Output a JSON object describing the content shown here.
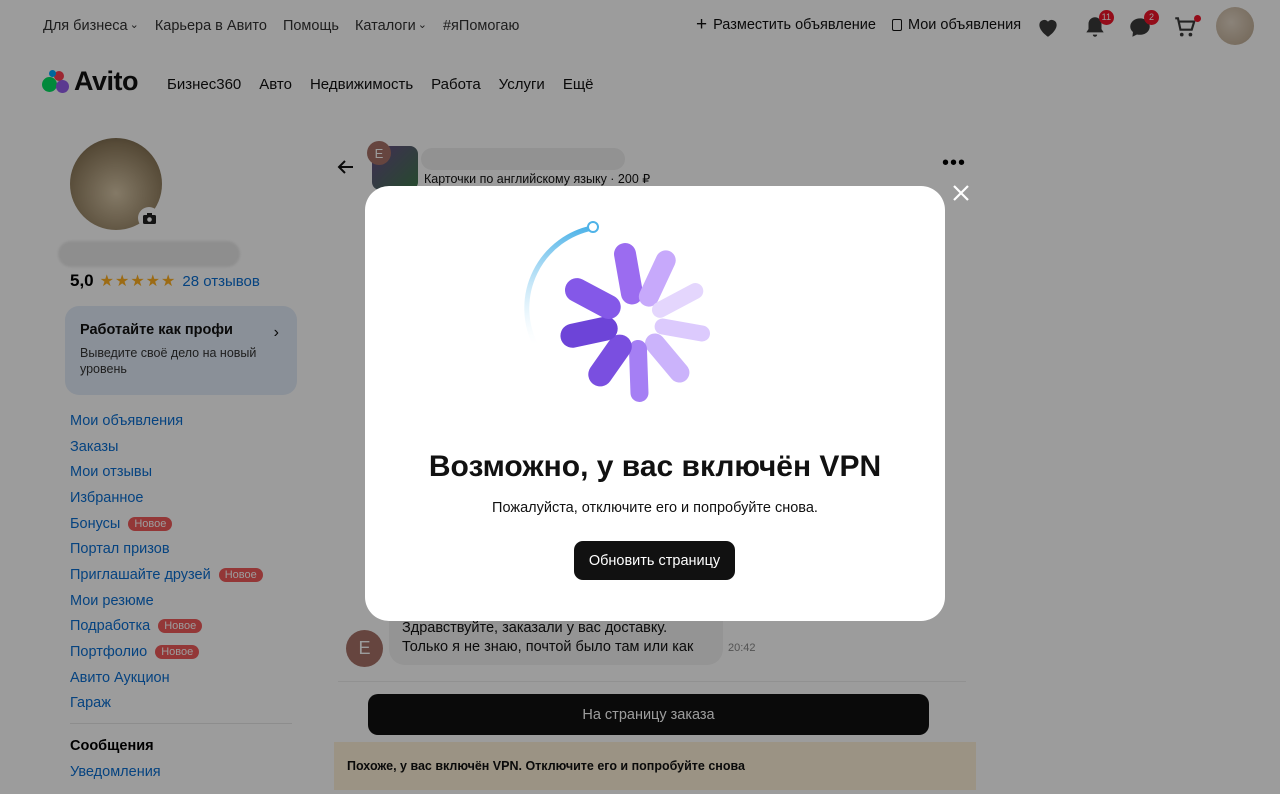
{
  "topbar": {
    "links": [
      {
        "label": "Для бизнеса",
        "dropdown": true
      },
      {
        "label": "Карьера в Авито",
        "dropdown": false
      },
      {
        "label": "Помощь",
        "dropdown": false
      },
      {
        "label": "Каталоги",
        "dropdown": true
      },
      {
        "label": "#яПомогаю",
        "dropdown": false
      }
    ],
    "post_ad": "Разместить объявление",
    "my_ads": "Мои объявления",
    "notifications_count": "11",
    "messages_count": "2"
  },
  "logo": {
    "text": "Avito"
  },
  "nav": {
    "items": [
      "Бизнес360",
      "Авто",
      "Недвижимость",
      "Работа",
      "Услуги",
      "Ещё"
    ]
  },
  "profile": {
    "rating": "5,0",
    "stars": 5,
    "reviews": "28 отзывов"
  },
  "promo": {
    "title": "Работайте как профи",
    "subtitle": "Выведите своё дело на новый уровень"
  },
  "sidebar": {
    "items": [
      {
        "label": "Мои объявления",
        "badge": ""
      },
      {
        "label": "Заказы",
        "badge": ""
      },
      {
        "label": "Мои отзывы",
        "badge": ""
      },
      {
        "label": "Избранное",
        "badge": ""
      },
      {
        "label": "Бонусы",
        "badge": "Новое"
      },
      {
        "label": "Портал призов",
        "badge": ""
      },
      {
        "label": "Приглашайте друзей",
        "badge": "Новое"
      },
      {
        "label": "Мои резюме",
        "badge": ""
      },
      {
        "label": "Подработка",
        "badge": "Новое"
      },
      {
        "label": "Портфолио",
        "badge": "Новое"
      },
      {
        "label": "Авито Аукцион",
        "badge": ""
      },
      {
        "label": "Гараж",
        "badge": ""
      }
    ],
    "messages_heading": "Сообщения",
    "notifications_link": "Уведомления"
  },
  "chat": {
    "avatar_letter": "E",
    "subtitle": "Карточки по английскому языку · 200 ₽",
    "message": "Здравствуйте, заказали у вас доставку. Только я не знаю, почтой было там или как",
    "message_time": "20:42",
    "order_button": "На страницу заказа",
    "vpn_notice": "Похоже, у вас включён VPN. Отключите его и попробуйте снова"
  },
  "modal": {
    "title": "Возможно, у вас включён VPN",
    "subtitle": "Пожалуйста, отключите его и попробуйте снова.",
    "refresh_button": "Обновить страницу"
  },
  "colors": {
    "link": "#0a6ed1",
    "badge_red": "#f05a5a",
    "notice_bg": "#fdf1d8",
    "promo_bg": "#e2ecf8",
    "spinner_purple": "#8b5cf6"
  }
}
